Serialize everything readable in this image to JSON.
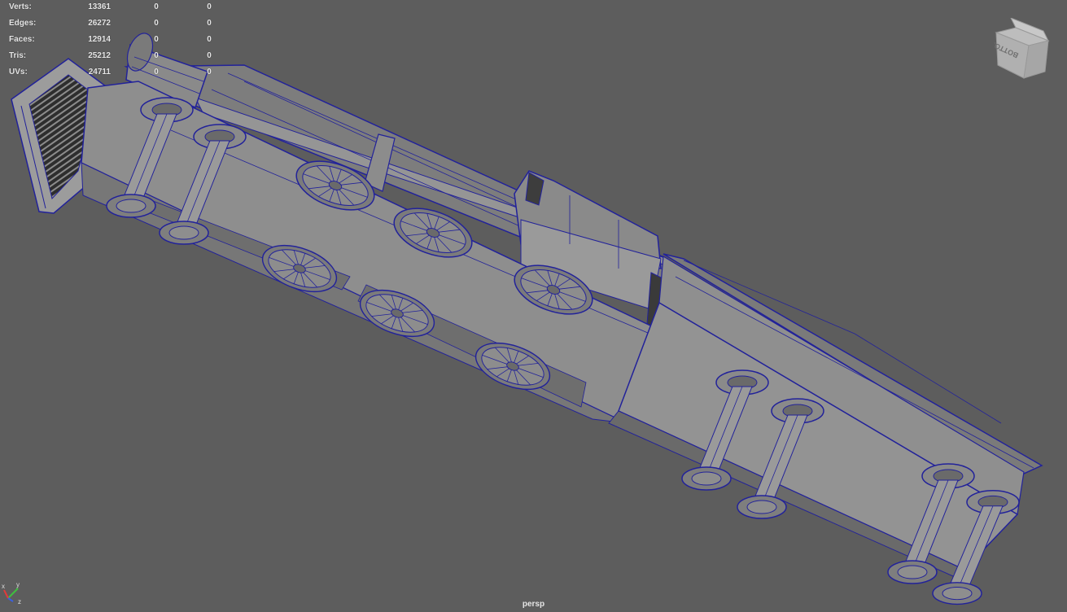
{
  "stats": [
    {
      "label": "Verts:",
      "value": "13361",
      "sel": "0",
      "sel_comp": "0"
    },
    {
      "label": "Edges:",
      "value": "26272",
      "sel": "0",
      "sel_comp": "0"
    },
    {
      "label": "Faces:",
      "value": "12914",
      "sel": "0",
      "sel_comp": "0"
    },
    {
      "label": "Tris:",
      "value": "25212",
      "sel": "0",
      "sel_comp": "0"
    },
    {
      "label": "UVs:",
      "value": "24711",
      "sel": "0",
      "sel_comp": "0"
    }
  ],
  "viewport": {
    "camera": "persp",
    "background": "#5d5d5d"
  },
  "view_cube": {
    "face_label": "BOTTOM",
    "icon": "view-cube-icon"
  },
  "axis_gizmo": {
    "icon": "axis-gizmo-icon",
    "x_label": "x",
    "y_label": "y",
    "z_label": "z"
  },
  "model": {
    "name": "locomotive",
    "icon": "locomotive-mesh-icon",
    "wire_color": "#22229a",
    "face_color": "#8a8a8a"
  }
}
